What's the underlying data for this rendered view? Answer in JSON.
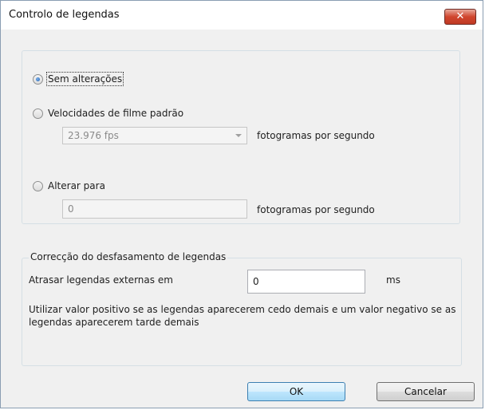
{
  "dialog": {
    "title": "Controlo de legendas",
    "close_glyph": "✕"
  },
  "framerate": {
    "option_no_change": "Sem alterações",
    "option_standard": "Velocidades de filme padrão",
    "standard_select_value": "23.976 fps",
    "standard_unit": "fotogramas por segundo",
    "option_change_to": "Alterar para",
    "change_to_value": "0",
    "change_to_unit": "fotogramas por segundo",
    "selected_option": "Sem alterações"
  },
  "offset": {
    "legend": "Correcção do desfasamento de legendas",
    "delay_label": "Atrasar legendas externas em",
    "delay_value": "0",
    "delay_unit": "ms",
    "help_text": "Utilizar valor positivo se as legendas aparecerem cedo demais e um valor negativo se as legendas aparecerem tarde demais"
  },
  "buttons": {
    "ok": "OK",
    "cancel": "Cancelar"
  },
  "colors": {
    "close_button": "#d0462e",
    "default_button_border": "#3c7fb1",
    "radio_selected": "#1b5fb4"
  }
}
